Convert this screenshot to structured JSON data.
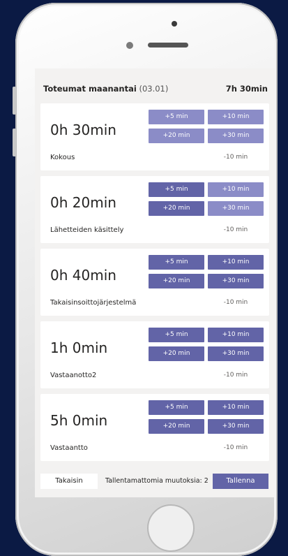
{
  "header": {
    "title": "Toteumat maanantai",
    "date": "(03.01)",
    "total": "7h 30min"
  },
  "buttons": {
    "plus5": "+5 min",
    "plus10": "+10 min",
    "plus20": "+20 min",
    "plus30": "+30 min",
    "minus10": "-10 min"
  },
  "entries": [
    {
      "duration": "0h 30min",
      "task": "Kokous"
    },
    {
      "duration": "0h 20min",
      "task": "Lähetteiden käsittely"
    },
    {
      "duration": "0h 40min",
      "task": "Takaisinsoittojärjestelmä"
    },
    {
      "duration": "1h 0min",
      "task": "Vastaanotto2"
    },
    {
      "duration": "5h 0min",
      "task": "Vastaantto"
    }
  ],
  "footer": {
    "back_label": "Takaisin",
    "unsaved_text": "Tallentamattomia muutoksia: 2",
    "save_label": "Tallenna"
  },
  "colors": {
    "accent": "#6264a7",
    "background": "#0b1a44"
  }
}
